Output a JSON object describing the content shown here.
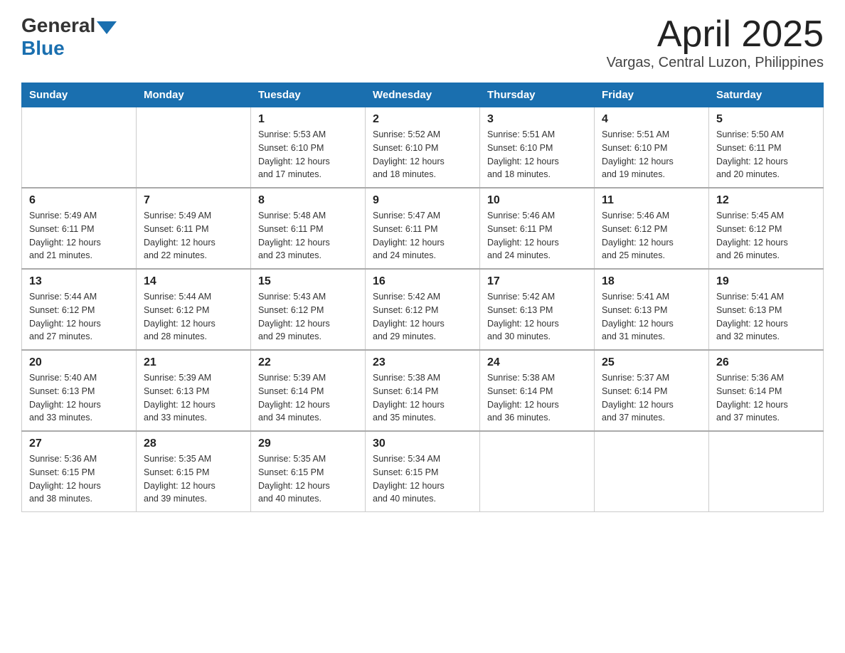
{
  "header": {
    "logo_general": "General",
    "logo_blue": "Blue",
    "title": "April 2025",
    "subtitle": "Vargas, Central Luzon, Philippines"
  },
  "weekdays": [
    "Sunday",
    "Monday",
    "Tuesday",
    "Wednesday",
    "Thursday",
    "Friday",
    "Saturday"
  ],
  "weeks": [
    [
      {
        "day": "",
        "info": ""
      },
      {
        "day": "",
        "info": ""
      },
      {
        "day": "1",
        "info": "Sunrise: 5:53 AM\nSunset: 6:10 PM\nDaylight: 12 hours\nand 17 minutes."
      },
      {
        "day": "2",
        "info": "Sunrise: 5:52 AM\nSunset: 6:10 PM\nDaylight: 12 hours\nand 18 minutes."
      },
      {
        "day": "3",
        "info": "Sunrise: 5:51 AM\nSunset: 6:10 PM\nDaylight: 12 hours\nand 18 minutes."
      },
      {
        "day": "4",
        "info": "Sunrise: 5:51 AM\nSunset: 6:10 PM\nDaylight: 12 hours\nand 19 minutes."
      },
      {
        "day": "5",
        "info": "Sunrise: 5:50 AM\nSunset: 6:11 PM\nDaylight: 12 hours\nand 20 minutes."
      }
    ],
    [
      {
        "day": "6",
        "info": "Sunrise: 5:49 AM\nSunset: 6:11 PM\nDaylight: 12 hours\nand 21 minutes."
      },
      {
        "day": "7",
        "info": "Sunrise: 5:49 AM\nSunset: 6:11 PM\nDaylight: 12 hours\nand 22 minutes."
      },
      {
        "day": "8",
        "info": "Sunrise: 5:48 AM\nSunset: 6:11 PM\nDaylight: 12 hours\nand 23 minutes."
      },
      {
        "day": "9",
        "info": "Sunrise: 5:47 AM\nSunset: 6:11 PM\nDaylight: 12 hours\nand 24 minutes."
      },
      {
        "day": "10",
        "info": "Sunrise: 5:46 AM\nSunset: 6:11 PM\nDaylight: 12 hours\nand 24 minutes."
      },
      {
        "day": "11",
        "info": "Sunrise: 5:46 AM\nSunset: 6:12 PM\nDaylight: 12 hours\nand 25 minutes."
      },
      {
        "day": "12",
        "info": "Sunrise: 5:45 AM\nSunset: 6:12 PM\nDaylight: 12 hours\nand 26 minutes."
      }
    ],
    [
      {
        "day": "13",
        "info": "Sunrise: 5:44 AM\nSunset: 6:12 PM\nDaylight: 12 hours\nand 27 minutes."
      },
      {
        "day": "14",
        "info": "Sunrise: 5:44 AM\nSunset: 6:12 PM\nDaylight: 12 hours\nand 28 minutes."
      },
      {
        "day": "15",
        "info": "Sunrise: 5:43 AM\nSunset: 6:12 PM\nDaylight: 12 hours\nand 29 minutes."
      },
      {
        "day": "16",
        "info": "Sunrise: 5:42 AM\nSunset: 6:12 PM\nDaylight: 12 hours\nand 29 minutes."
      },
      {
        "day": "17",
        "info": "Sunrise: 5:42 AM\nSunset: 6:13 PM\nDaylight: 12 hours\nand 30 minutes."
      },
      {
        "day": "18",
        "info": "Sunrise: 5:41 AM\nSunset: 6:13 PM\nDaylight: 12 hours\nand 31 minutes."
      },
      {
        "day": "19",
        "info": "Sunrise: 5:41 AM\nSunset: 6:13 PM\nDaylight: 12 hours\nand 32 minutes."
      }
    ],
    [
      {
        "day": "20",
        "info": "Sunrise: 5:40 AM\nSunset: 6:13 PM\nDaylight: 12 hours\nand 33 minutes."
      },
      {
        "day": "21",
        "info": "Sunrise: 5:39 AM\nSunset: 6:13 PM\nDaylight: 12 hours\nand 33 minutes."
      },
      {
        "day": "22",
        "info": "Sunrise: 5:39 AM\nSunset: 6:14 PM\nDaylight: 12 hours\nand 34 minutes."
      },
      {
        "day": "23",
        "info": "Sunrise: 5:38 AM\nSunset: 6:14 PM\nDaylight: 12 hours\nand 35 minutes."
      },
      {
        "day": "24",
        "info": "Sunrise: 5:38 AM\nSunset: 6:14 PM\nDaylight: 12 hours\nand 36 minutes."
      },
      {
        "day": "25",
        "info": "Sunrise: 5:37 AM\nSunset: 6:14 PM\nDaylight: 12 hours\nand 37 minutes."
      },
      {
        "day": "26",
        "info": "Sunrise: 5:36 AM\nSunset: 6:14 PM\nDaylight: 12 hours\nand 37 minutes."
      }
    ],
    [
      {
        "day": "27",
        "info": "Sunrise: 5:36 AM\nSunset: 6:15 PM\nDaylight: 12 hours\nand 38 minutes."
      },
      {
        "day": "28",
        "info": "Sunrise: 5:35 AM\nSunset: 6:15 PM\nDaylight: 12 hours\nand 39 minutes."
      },
      {
        "day": "29",
        "info": "Sunrise: 5:35 AM\nSunset: 6:15 PM\nDaylight: 12 hours\nand 40 minutes."
      },
      {
        "day": "30",
        "info": "Sunrise: 5:34 AM\nSunset: 6:15 PM\nDaylight: 12 hours\nand 40 minutes."
      },
      {
        "day": "",
        "info": ""
      },
      {
        "day": "",
        "info": ""
      },
      {
        "day": "",
        "info": ""
      }
    ]
  ]
}
